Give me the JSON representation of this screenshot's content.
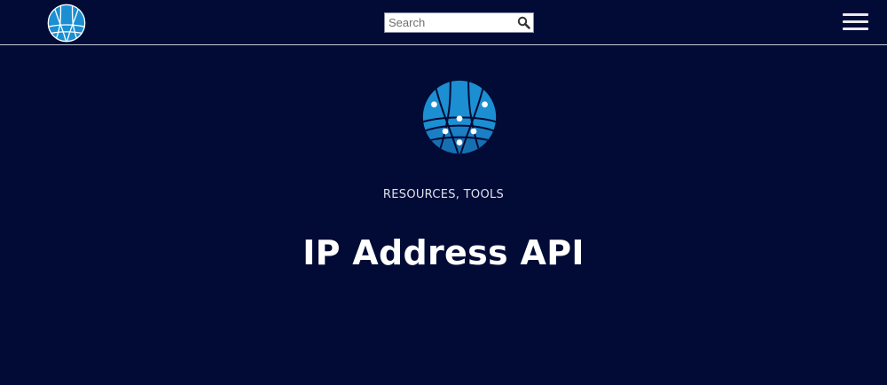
{
  "header": {
    "logo_icon": "globe-network-icon",
    "search": {
      "placeholder": "Search",
      "value": "",
      "button_icon": "magnifier-icon"
    },
    "menu_icon": "hamburger-menu-icon"
  },
  "hero": {
    "logo_icon": "globe-network-icon",
    "categories": [
      "RESOURCES",
      "TOOLS"
    ],
    "category_separator": ", ",
    "title": "IP Address API"
  },
  "colors": {
    "background": "#020b36",
    "logo_blue": "#1b8fd1",
    "text": "#ffffff",
    "divider": "#c9ccd8"
  }
}
